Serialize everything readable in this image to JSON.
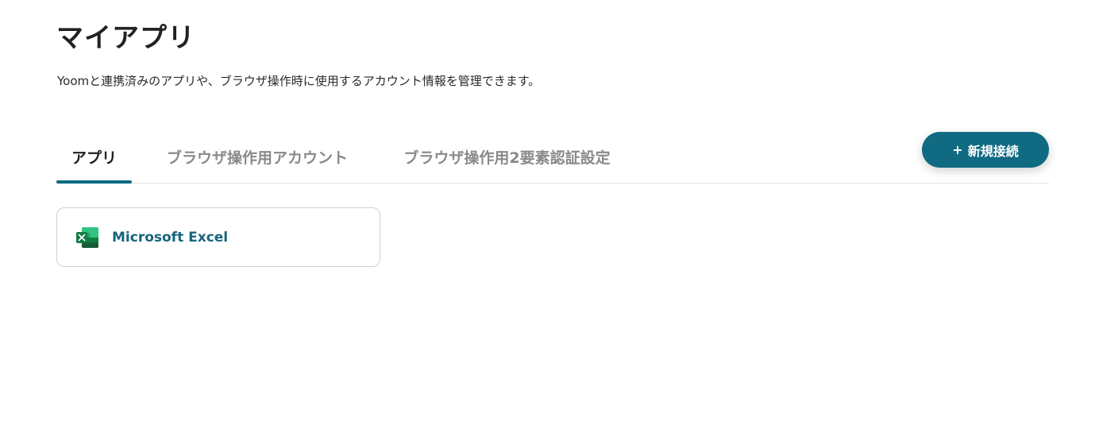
{
  "page": {
    "title": "マイアプリ",
    "description": "Yoomと連携済みのアプリや、ブラウザ操作時に使用するアカウント情報を管理できます。"
  },
  "tabs": [
    {
      "label": "アプリ",
      "active": true
    },
    {
      "label": "ブラウザ操作用アカウント",
      "active": false
    },
    {
      "label": "ブラウザ操作用2要素認証設定",
      "active": false
    }
  ],
  "actions": {
    "new_connection_plus": "+",
    "new_connection_label": "新規接続"
  },
  "apps": [
    {
      "name": "Microsoft Excel",
      "icon": "excel-icon"
    }
  ],
  "colors": {
    "accent": "#0f6a82",
    "app_name": "#17657e",
    "tab_inactive": "#8a8a8a"
  }
}
